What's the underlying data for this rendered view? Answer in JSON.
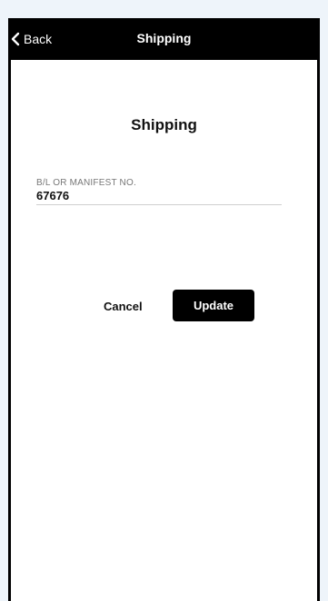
{
  "nav": {
    "back_label": "Back",
    "title": "Shipping"
  },
  "page": {
    "title": "Shipping"
  },
  "form": {
    "bl_manifest": {
      "label": "B/L OR MANIFEST NO.",
      "value": "67676"
    }
  },
  "actions": {
    "cancel_label": "Cancel",
    "update_label": "Update"
  },
  "colors": {
    "background": "#eef4fa",
    "nav_bar": "#000000",
    "surface": "#ffffff",
    "primary_button": "#000000"
  },
  "icons": {
    "back": "chevron-left-icon"
  }
}
